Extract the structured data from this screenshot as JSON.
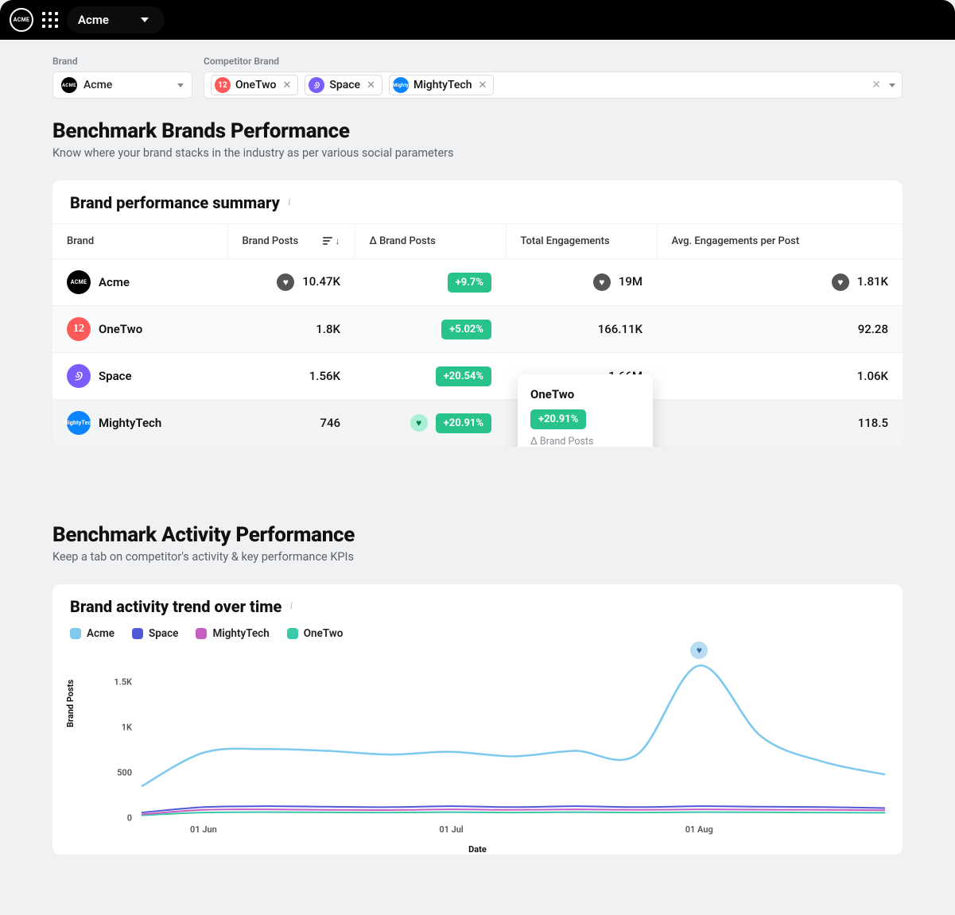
{
  "topbar": {
    "logo_text": "ACME",
    "brand_name": "Acme"
  },
  "filters": {
    "brand_label": "Brand",
    "comp_label": "Competitor Brand",
    "brand_selected": "Acme",
    "competitors": [
      {
        "name": "OneTwo",
        "avatar_class": "av-onetwo",
        "avatar_text": "12"
      },
      {
        "name": "Space",
        "avatar_class": "av-space",
        "avatar_text": "୬"
      },
      {
        "name": "MightyTech",
        "avatar_class": "av-mighty",
        "avatar_text": "Mighty"
      }
    ]
  },
  "section1": {
    "title": "Benchmark Brands Performance",
    "subtitle": "Know where your brand stacks in the industry as per various social parameters",
    "card_title": "Brand performance summary",
    "columns": {
      "brand": "Brand",
      "posts": "Brand Posts",
      "delta": "Δ Brand Posts",
      "eng": "Total Engagements",
      "avg": "Avg. Engagements per Post"
    },
    "rows": [
      {
        "name": "Acme",
        "avatar_class": "avl-acme",
        "avatar_text": "ACME",
        "posts": "10.47K",
        "posts_bulb": "bulb-dark",
        "delta": "+9.7%",
        "delta_bulb": "",
        "eng": "19M",
        "eng_bulb": "bulb-dark",
        "avg": "1.81K",
        "avg_bulb": "bulb-dark"
      },
      {
        "name": "OneTwo",
        "avatar_class": "avl-onetwo",
        "avatar_text": "12",
        "posts": "1.8K",
        "posts_bulb": "",
        "delta": "+5.02%",
        "delta_bulb": "",
        "eng": "166.11K",
        "eng_bulb": "",
        "avg": "92.28",
        "avg_bulb": ""
      },
      {
        "name": "Space",
        "avatar_class": "avl-space",
        "avatar_text": "୬",
        "posts": "1.56K",
        "posts_bulb": "",
        "delta": "+20.54%",
        "delta_bulb": "",
        "eng": "1.66M",
        "eng_bulb": "",
        "avg": "1.06K",
        "avg_bulb": ""
      },
      {
        "name": "MightyTech",
        "avatar_class": "avl-mighty",
        "avatar_text": "MightyTech",
        "posts": "746",
        "posts_bulb": "",
        "delta": "+20.91%",
        "delta_bulb": "bulb-mint",
        "eng": "",
        "eng_bulb": "",
        "avg": "118.5",
        "avg_bulb": ""
      }
    ],
    "tooltip": {
      "title": "OneTwo",
      "badge": "+20.91%",
      "subtitle": "Δ Brand Posts"
    }
  },
  "section2": {
    "title": "Benchmark Activity Performance",
    "subtitle": "Keep a tab on competitor's activity & key performance KPIs",
    "card_title": "Brand activity trend over time",
    "legend": [
      {
        "name": "Acme",
        "color": "#7ec9ed"
      },
      {
        "name": "Space",
        "color": "#5158d8"
      },
      {
        "name": "MightyTech",
        "color": "#c85fc0"
      },
      {
        "name": "OneTwo",
        "color": "#38c9a9"
      }
    ],
    "ylabel": "Brand Posts",
    "xlabel": "Date"
  },
  "chart_data": {
    "type": "line",
    "title": "Brand activity trend over time",
    "xlabel": "Date",
    "ylabel": "Brand Posts",
    "ylim": [
      0,
      1700
    ],
    "yticks": [
      0,
      500,
      1000,
      1500
    ],
    "ytick_labels": [
      "0",
      "500",
      "1K",
      "1.5K"
    ],
    "x_tick_labels": [
      "01 Jun",
      "01 Jul",
      "01 Aug"
    ],
    "x_tick_positions": [
      1,
      5,
      9
    ],
    "x_index": [
      0,
      1,
      2,
      3,
      4,
      5,
      6,
      7,
      8,
      9,
      10,
      11,
      12
    ],
    "series": [
      {
        "name": "Acme",
        "color": "#7ec9ed",
        "values": [
          350,
          720,
          760,
          740,
          700,
          730,
          680,
          740,
          700,
          1680,
          900,
          620,
          480
        ]
      },
      {
        "name": "Space",
        "color": "#5158d8",
        "values": [
          60,
          120,
          130,
          125,
          120,
          130,
          120,
          130,
          120,
          130,
          125,
          120,
          110
        ]
      },
      {
        "name": "MightyTech",
        "color": "#c85fc0",
        "values": [
          40,
          90,
          95,
          90,
          88,
          95,
          90,
          95,
          90,
          95,
          92,
          90,
          85
        ]
      },
      {
        "name": "OneTwo",
        "color": "#38c9a9",
        "values": [
          30,
          60,
          65,
          62,
          60,
          65,
          60,
          65,
          60,
          65,
          63,
          60,
          58
        ]
      }
    ],
    "marker": {
      "series": "Acme",
      "x_index": 9
    }
  }
}
